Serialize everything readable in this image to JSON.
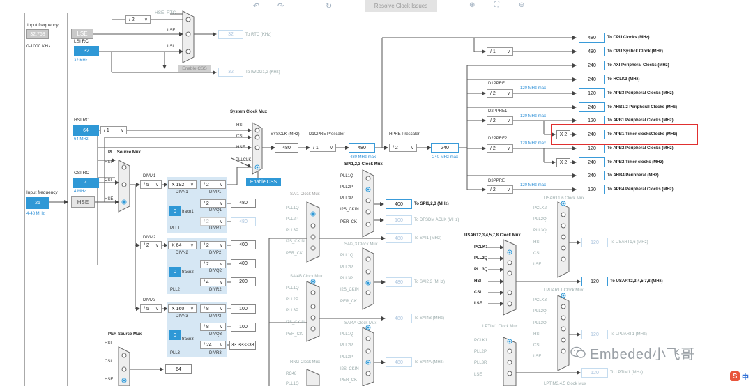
{
  "toolbar": {
    "undo_icon": "undo-icon",
    "redo_icon": "redo-icon",
    "refresh_icon": "refresh-icon",
    "resolve_label": "Resolve Clock Issues",
    "zoom_in_icon": "zoom-in-icon",
    "fit_icon": "fit-icon",
    "zoom_out_icon": "zoom-out-icon"
  },
  "lse_section": {
    "input_freq_label": "Input frequency",
    "input_freq_value": "32.768",
    "input_range": "0-1000 KHz",
    "lse_label": "LSE",
    "lsi_rc_label": "LSI RC",
    "lsi_value": "32",
    "lsi_khz": "32 KHz",
    "div_value": "/ 2",
    "hse_rtc_label": "HSE_RTC",
    "lse_in": "LSE",
    "lsi_in": "LSI",
    "rtc_value": "32",
    "rtc_label": "To RTC (KHz)",
    "enable_css_label": "Enable CSS",
    "iwdg_value": "32",
    "iwdg_label": "To IWDG1,2 (KHz)"
  },
  "hsi_section": {
    "hsi_rc_label": "HSI RC",
    "hsi_value": "64",
    "hsi_mhz": "64 MHz",
    "hsi_div": "/ 1",
    "csi_rc_label": "CSI RC",
    "csi_value": "4",
    "csi_mhz": "4 MHz"
  },
  "hse_section": {
    "input_freq_label": "Input frequency",
    "value": "25",
    "range": "4-48 MHz",
    "hse_label": "HSE"
  },
  "pll_source_mux": {
    "title": "PLL Source Mux",
    "inputs": [
      "HSI",
      "CSI",
      "HSE"
    ]
  },
  "pll1": {
    "divm_label": "DIVM1",
    "divm": "/ 5",
    "divn": "X 192",
    "divn_label": "DIVN1",
    "divp": "/ 2",
    "divp_label": "DIVP1",
    "divq": "/ 2",
    "divq_label": "DIVQ1",
    "divr": "/ 2",
    "divr_label": "DIVR1",
    "frac_value": "0",
    "frac_label": "fracn1",
    "q_out": "480",
    "r_out": "480",
    "name": "PLL1"
  },
  "pll2": {
    "divm_label": "DIVM2",
    "divm": "/ 2",
    "divn": "X 64",
    "divn_label": "DIVN2",
    "divp": "/ 2",
    "divp_label": "DIVP2",
    "divq": "/ 2",
    "divq_label": "DIVQ2",
    "divr": "/ 4",
    "divr_label": "DIVR2",
    "frac_value": "0",
    "frac_label": "fracn2",
    "p_out": "400",
    "q_out": "400",
    "r_out": "200",
    "name": "PLL2"
  },
  "pll3": {
    "divm_label": "DIVM3",
    "divm": "/ 5",
    "divn": "X 160",
    "divn_label": "DIVN3",
    "divp": "/ 8",
    "divp_label": "DIVP3",
    "divq": "/ 8",
    "divq_label": "DIVQ3",
    "divr": "/ 24",
    "divr_label": "DIVR3",
    "frac_value": "0",
    "frac_label": "fracn3",
    "p_out": "100",
    "q_out": "100",
    "r_out": "33.333333",
    "name": "PLL3"
  },
  "per_source_mux": {
    "title": "PER Source Mux",
    "inputs": [
      "HSI",
      "CSI",
      "HSE"
    ],
    "out": "64"
  },
  "system_clock_mux": {
    "title": "System Clock Mux",
    "inputs": [
      "HSI",
      "CSI",
      "HSE",
      "PLLCLK"
    ],
    "sysclk_label": "SYSCLK (MHz)",
    "sysclk_value": "480",
    "d1cpre_label": "D1CPRE Prescaler",
    "d1cpre": "/ 1",
    "d1cpre_out": "480",
    "d1cpre_max": "480 MHz max",
    "hpre_label": "HPRE Prescaler",
    "hpre": "/ 2",
    "hpre_out": "240",
    "hpre_max": "240 MHz max",
    "enable_css_label": "Enable CSS"
  },
  "outputs": {
    "cpu_div": "/ 1",
    "d1ppre_label": "D1PPRE",
    "d1ppre": "/ 2",
    "d2ppre1_label": "D2PPRE1",
    "d2ppre1": "/ 2",
    "d2ppre2_label": "D2PPRE2",
    "d2ppre2": "/ 2",
    "d3ppre_label": "D3PPRE",
    "d3ppre": "/ 2",
    "max120": "120 MHz max",
    "x2_a": "X 2",
    "x2_b": "X 2",
    "rows": [
      {
        "value": "480",
        "label": "To CPU Clocks (MHz)"
      },
      {
        "value": "480",
        "label": "To CPU Systick Clock (MHz)"
      },
      {
        "value": "240",
        "label": "To AXI Peripheral Clocks (MHz)"
      },
      {
        "value": "240",
        "label": "To HCLK3 (MHz)"
      },
      {
        "value": "120",
        "label": "To APB3 Peripheral Clocks (MHz)"
      },
      {
        "value": "240",
        "label": "To AHB1,2 Peripheral Clocks (MHz)"
      },
      {
        "value": "120",
        "label": "To APB1 Peripheral Clocks (MHz)"
      },
      {
        "value": "240",
        "label": "To APB1 Timer clocksClocks (MHz)"
      },
      {
        "value": "120",
        "label": "To APB2 Peripheral Clocks (MHz)"
      },
      {
        "value": "240",
        "label": "To APB2 Timer clocks (MHz)"
      },
      {
        "value": "240",
        "label": "To AHB4 Peripheral (MHz)"
      },
      {
        "value": "120",
        "label": "To APB4 Peripheral Clocks (MHz)"
      }
    ]
  },
  "spi123_mux": {
    "title": "SPI1,2,3 Clock Mux",
    "inputs": [
      "PLL1Q",
      "PLL2P",
      "PLL3P",
      "I2S_CKIN",
      "PER_CK"
    ],
    "out_value": "400",
    "out_label": "To SPI1,2,3 (MHz)",
    "dfsdm_value": "100",
    "dfsdm_label": "To DFSDM ACLK (MHz)"
  },
  "sai1_mux": {
    "title": "SAI1 Clock Mux",
    "inputs": [
      "PLL1Q",
      "PLL2P",
      "PLL3P",
      "I2S_CKIN",
      "PER_CK"
    ],
    "out_value": "480",
    "out_label": "To SAI1 (MHz)"
  },
  "sai23_mux": {
    "title": "SAI2,3 Clock Mux",
    "inputs": [
      "PLL1Q",
      "PLL2P",
      "PLL3P",
      "I2S_CKIN",
      "PER_CK"
    ],
    "out_value": "480",
    "out_label": "To SAI2,3 (MHz)"
  },
  "sai4b_mux": {
    "title": "SAI4B Clock Mux",
    "inputs": [
      "PLL1Q",
      "PLL2P",
      "PLL3P",
      "I2S_CKIN",
      "PER_CK"
    ],
    "out_value": "480",
    "out_label": "To SAI4B (MHz)"
  },
  "sai4a_mux": {
    "title": "SAI4A Clock Mux",
    "inputs": [
      "PLL1Q",
      "PLL2P",
      "PLL3P",
      "I2S_CKIN",
      "PER_CK"
    ],
    "out_value": "480",
    "out_label": "To SAI4A (MHz)"
  },
  "rng_mux": {
    "title": "RNG Clock Mux",
    "inputs": [
      "RC48",
      "PLL1Q"
    ]
  },
  "usart16_mux": {
    "title": "USART1,6 Clock Mux",
    "inputs": [
      "PCLK2",
      "PLL2Q",
      "PLL3Q",
      "HSI",
      "CSI",
      "LSE"
    ],
    "out_value": "120",
    "out_label": "To USART1,6 (MHz)"
  },
  "usart2_mux": {
    "title": "USART2,3,4,5,7,8 Clock Mux",
    "inputs": [
      "PCLK1",
      "PLL2Q",
      "PLL3Q",
      "HSI",
      "CSI",
      "LSE"
    ],
    "out_value": "120",
    "out_label": "To USART2,3,4,5,7,8 (MHz)"
  },
  "lpuart1_mux": {
    "title": "LPUART1 Clock Mux",
    "inputs": [
      "PCLK3",
      "PLL2Q",
      "PLL3Q",
      "HSI",
      "CSI",
      "LSE"
    ],
    "out_value": "120",
    "out_label": "To LPUART1 (MHz)"
  },
  "lptim1_mux": {
    "title": "LPTIM1 Clock Mux",
    "inputs": [
      "PCLK1",
      "PLL2P",
      "PLL3R",
      "LSE"
    ],
    "out_value": "120",
    "out_label": "To LPTIM1 (MHz)"
  },
  "lptim345": {
    "title": "LPTIM3,4,5 Clock Mux"
  },
  "watermark": {
    "text": "Embeded小飞哥",
    "icon": "wechat-icon",
    "corner_icon": "sogou-ime-icon",
    "corner_text": "中"
  },
  "colors": {
    "accent": "#2f98d6",
    "highlight": "#e03030",
    "pll_bg": "#d6e7f4"
  }
}
